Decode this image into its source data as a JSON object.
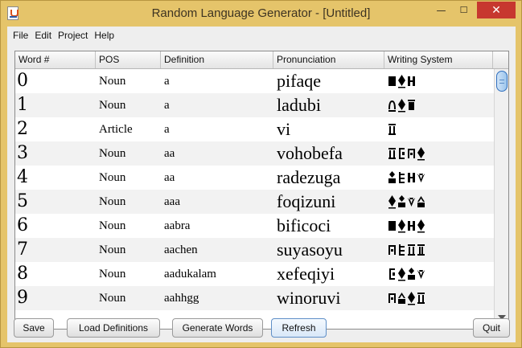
{
  "window": {
    "title": "Random Language Generator - [Untitled]",
    "minimize_glyph": "—",
    "maximize_glyph": "☐",
    "close_glyph": "✕"
  },
  "menu": [
    {
      "label": "File"
    },
    {
      "label": "Edit"
    },
    {
      "label": "Project"
    },
    {
      "label": "Help"
    }
  ],
  "table": {
    "columns": [
      "Word #",
      "POS",
      "Definition",
      "Pronunciation",
      "Writing System"
    ],
    "rows": [
      {
        "num": "0",
        "pos": "Noun",
        "def": "a",
        "pron": "pifaqe",
        "glyphs": [
          "g0",
          "g1",
          "g2"
        ]
      },
      {
        "num": "1",
        "pos": "Noun",
        "def": "a",
        "pron": "ladubi",
        "glyphs": [
          "g3",
          "g1",
          "g4"
        ]
      },
      {
        "num": "2",
        "pos": "Article",
        "def": "a",
        "pron": "vi",
        "glyphs": [
          "g5"
        ]
      },
      {
        "num": "3",
        "pos": "Noun",
        "def": "aa",
        "pron": "vohobefa",
        "glyphs": [
          "g5",
          "g6",
          "g7",
          "g1"
        ]
      },
      {
        "num": "4",
        "pos": "Noun",
        "def": "aa",
        "pron": "radezuga",
        "glyphs": [
          "g8",
          "g9",
          "g2",
          "g10"
        ]
      },
      {
        "num": "5",
        "pos": "Noun",
        "def": "aaa",
        "pron": "foqizuni",
        "glyphs": [
          "g1",
          "g8",
          "g10",
          "g11"
        ]
      },
      {
        "num": "6",
        "pos": "Noun",
        "def": "aabra",
        "pron": "bificoci",
        "glyphs": [
          "g0",
          "g1",
          "g2",
          "g1"
        ]
      },
      {
        "num": "7",
        "pos": "Noun",
        "def": "aachen",
        "pron": "suyasoyu",
        "glyphs": [
          "g7",
          "g9",
          "g5",
          "g12"
        ]
      },
      {
        "num": "8",
        "pos": "Noun",
        "def": "aadukalam",
        "pron": "xefeqiyi",
        "glyphs": [
          "g6",
          "g1",
          "g8",
          "g10"
        ]
      },
      {
        "num": "9",
        "pos": "Noun",
        "def": "aahhgg",
        "pron": "winoruvi",
        "glyphs": [
          "g7",
          "g11",
          "g1",
          "g5"
        ]
      }
    ]
  },
  "icons": {
    "app": "java-app-icon",
    "scroll_down": "scroll-down-arrow-icon"
  },
  "buttons": {
    "save": "Save",
    "load_definitions": "Load Definitions",
    "generate_words": "Generate Words",
    "refresh": "Refresh",
    "quit": "Quit"
  },
  "colors": {
    "title_bar": "#e5c46a",
    "close_button": "#c7372f",
    "alt_row": "#f2f2f2",
    "scroll_thumb": "#9cc5ec"
  }
}
